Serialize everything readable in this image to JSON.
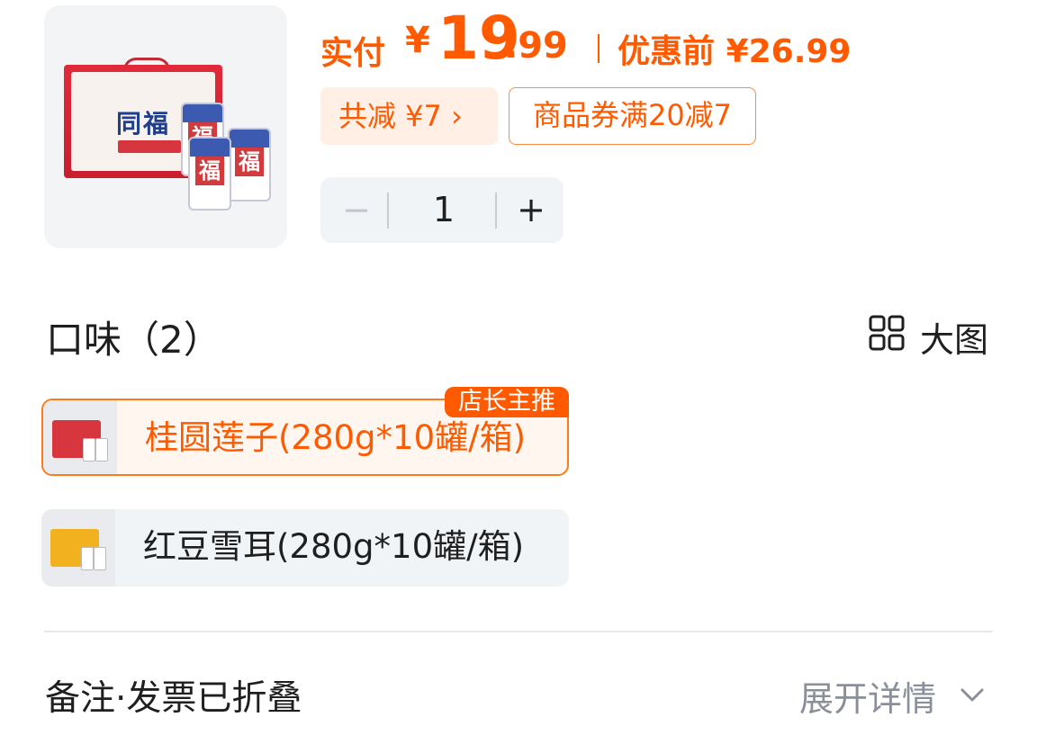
{
  "product": {
    "image_icon": "product-gift-box-image",
    "box_brand": "同福",
    "can_char": "福"
  },
  "price": {
    "label": "实付",
    "currency": "¥",
    "integer": "19",
    "decimal": ".99",
    "original_label": "优惠前",
    "original": "¥26.99",
    "color": "#ff5a00"
  },
  "discount": {
    "total_label": "共减 ¥7 ›",
    "coupon_label": "商品券满20减7"
  },
  "stepper": {
    "minus": "−",
    "quantity": "1",
    "plus": "+"
  },
  "flavor": {
    "title": "口味（2）",
    "big_pic_label": "大图",
    "badge": "店长主推",
    "options": [
      {
        "label": "桂圆莲子(280g*10罐/箱)",
        "selected": true,
        "box_color": "#d8363e"
      },
      {
        "label": "红豆雪耳(280g*10罐/箱)",
        "selected": false,
        "box_color": "#f2b11e"
      }
    ]
  },
  "footer": {
    "note_label": "备注·发票已折叠",
    "expand_label": "展开详情",
    "expand_icon": "chevron-down-icon"
  }
}
